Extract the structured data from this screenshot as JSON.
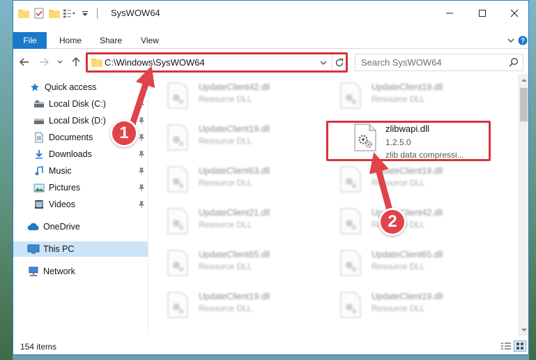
{
  "window": {
    "title": "SysWOW64",
    "accent": "#1979ca"
  },
  "ribbon": {
    "tabs": [
      "File",
      "Home",
      "Share",
      "View"
    ]
  },
  "address": {
    "path": "C:\\Windows\\SysWOW64"
  },
  "search": {
    "placeholder": "Search SysWOW64"
  },
  "nav": {
    "items": [
      {
        "label": "Quick access",
        "icon": "star-icon"
      },
      {
        "label": "Local Disk (C:)",
        "icon": "drive-icon"
      },
      {
        "label": "Local Disk (D:)",
        "icon": "drive-icon"
      },
      {
        "label": "Documents",
        "icon": "documents-icon"
      },
      {
        "label": "Downloads",
        "icon": "download-icon"
      },
      {
        "label": "Music",
        "icon": "music-icon"
      },
      {
        "label": "Pictures",
        "icon": "pictures-icon"
      },
      {
        "label": "Videos",
        "icon": "videos-icon"
      },
      {
        "label": "OneDrive",
        "icon": "cloud-icon"
      },
      {
        "label": "This PC",
        "icon": "computer-icon"
      },
      {
        "label": "Network",
        "icon": "network-icon"
      }
    ]
  },
  "files": {
    "col1": [
      {
        "name": "UpdateClient42.dll",
        "type": "Resource DLL"
      },
      {
        "name": "UpdateClient19.dll",
        "type": "Resource DLL"
      },
      {
        "name": "UpdateClient63.dll",
        "type": "Resource DLL"
      },
      {
        "name": "UpdateClient21.dll",
        "type": "Resource DLL"
      },
      {
        "name": "UpdateClient65.dll",
        "type": "Resource DLL"
      },
      {
        "name": "UpdateClient19.dll",
        "type": "Resource DLL"
      }
    ],
    "col2": [
      {
        "name": "UpdateClient19.dll",
        "type": "Resource DLL"
      },
      {
        "name": "UpdateClient19.dll",
        "type": "Resource DLL"
      },
      {
        "name": "UpdateClient42.dll",
        "type": "Resource DLL"
      },
      {
        "name": "UpdateClient65.dll",
        "type": "Resource DLL"
      },
      {
        "name": "UpdateClient19.dll",
        "type": "Resource DLL"
      }
    ],
    "highlighted": {
      "name": "zlibwapi.dll",
      "version": "1.2.5.0",
      "description": "zlib data compressi..."
    }
  },
  "status": {
    "count": "154 items"
  },
  "annotations": {
    "badge1": "1",
    "badge2": "2",
    "color": "#d9323b"
  }
}
